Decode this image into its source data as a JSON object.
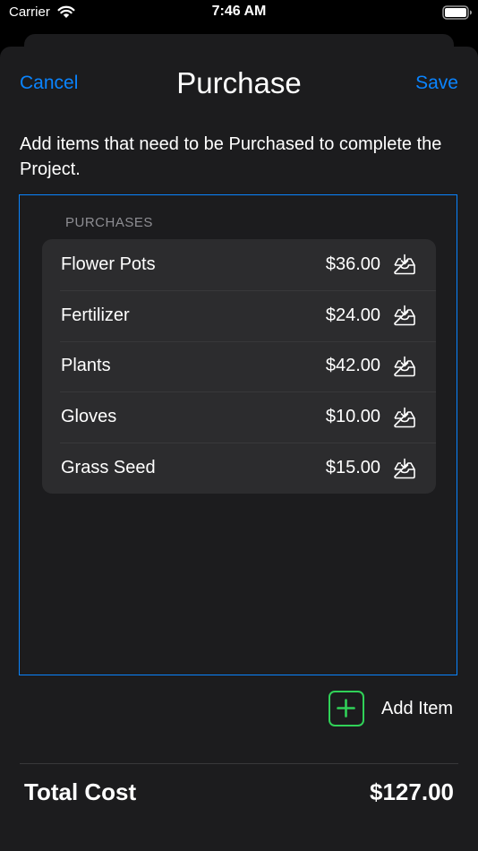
{
  "status_bar": {
    "carrier": "Carrier",
    "time": "7:46 AM"
  },
  "nav": {
    "cancel_label": "Cancel",
    "title": "Purchase",
    "save_label": "Save"
  },
  "description": "Add items that need to be Purchased to complete the Project.",
  "purchases": {
    "header": "PURCHASES",
    "items": [
      {
        "name": "Flower Pots",
        "price": "$36.00",
        "icon": "tray-download-icon"
      },
      {
        "name": "Fertilizer",
        "price": "$24.00",
        "icon": "tray-download-icon"
      },
      {
        "name": "Plants",
        "price": "$42.00",
        "icon": "tray-download-icon"
      },
      {
        "name": "Gloves",
        "price": "$10.00",
        "icon": "tray-download-icon"
      },
      {
        "name": "Grass Seed",
        "price": "$15.00",
        "icon": "tray-download-icon"
      }
    ]
  },
  "add_item": {
    "label": "Add Item",
    "icon": "plus-icon"
  },
  "total": {
    "label": "Total Cost",
    "value": "$127.00"
  },
  "colors": {
    "accent": "#0a84ff",
    "add_button": "#30d158",
    "background": "#1c1c1e",
    "card": "#2c2c2e"
  }
}
